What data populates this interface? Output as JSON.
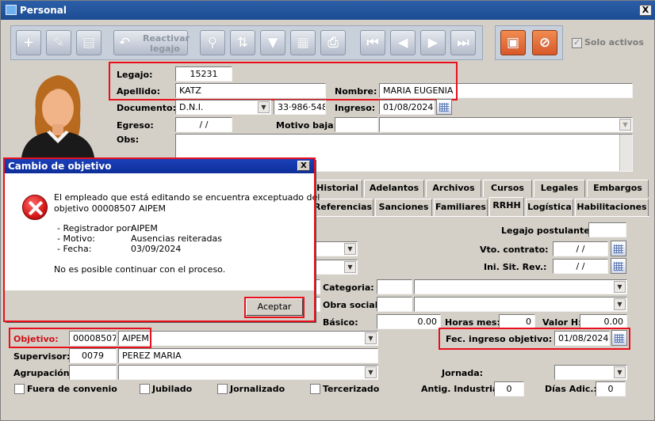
{
  "window": {
    "title": "Personal",
    "close": "X"
  },
  "toolbar": {
    "reactivate_label": "Reactivar\nlegajo",
    "solo_activos_label": "Solo activos",
    "solo_activos_checked": true
  },
  "form": {
    "legajo_label": "Legajo:",
    "legajo_value": "15231",
    "apellido_label": "Apellido:",
    "apellido_value": "KATZ",
    "nombre_label": "Nombre:",
    "nombre_value": "MARIA EUGENIA",
    "documento_label": "Documento:",
    "documento_type": "D.N.I.",
    "documento_number": "33·986·548",
    "ingreso_label": "Ingreso:",
    "ingreso_value": "01/08/2024",
    "egreso_label": "Egreso:",
    "egreso_value": "/ /",
    "motivo_baja_label": "Motivo baja:",
    "obs_label": "Obs:"
  },
  "tabs_row1": [
    "Historial",
    "Adelantos",
    "Archivos",
    "Cursos",
    "Legales",
    "Embargos"
  ],
  "tabs_row2": [
    "Referencias",
    "Sanciones",
    "Familiares",
    "RRHH",
    "Logística",
    "Habilitaciones"
  ],
  "rrhh": {
    "legajo_postulante_label": "Legajo postulante:",
    "vto_contrato_label": "Vto. contrato:",
    "vto_contrato_value": "/ /",
    "ini_sit_rev_label": "Ini. Sit. Rev.:",
    "ini_sit_rev_value": "/ /",
    "categoria_label": "Categoria:",
    "obra_social_label": "Obra social:",
    "basico_label": "Básico:",
    "basico_value": "0.00",
    "horas_mes_label": "Horas mes:",
    "horas_mes_value": "0",
    "valor_h_label": "Valor H:",
    "valor_h_value": "0.00",
    "objetivo_label": "Objetivo:",
    "objetivo_code": "00008507",
    "objetivo_name": "AIPEM",
    "fec_ingreso_objetivo_label": "Fec. ingreso objetivo:",
    "fec_ingreso_objetivo_value": "01/08/2024",
    "supervisor_label": "Supervisor:",
    "supervisor_code": "0079",
    "supervisor_name": "PEREZ MARIA",
    "agrupacion_label": "Agrupación:",
    "jornada_label": "Jornada:",
    "fuera_convenio_label": "Fuera de convenio",
    "jubilado_label": "Jubilado",
    "jornalizado_label": "Jornalizado",
    "tercerizado_label": "Tercerizado",
    "antig_industria_label": "Antig. Industria:",
    "antig_industria_value": "0",
    "dias_adic_label": "Días Adic.:",
    "dias_adic_value": "0"
  },
  "dialog": {
    "title": "Cambio de objetivo",
    "close": "X",
    "line1": "El empleado que está editando se encuentra exceptuado del",
    "line2": "objetivo 00008507 AIPEM",
    "registrador_label": "- Registrador por:",
    "registrador_value": "AIPEM",
    "motivo_label": "- Motivo:",
    "motivo_value": "Ausencias reiteradas",
    "fecha_label": "- Fecha:",
    "fecha_value": "03/09/2024",
    "footer": "No es posible continuar con el proceso.",
    "ok_button": "Aceptar"
  },
  "colors": {
    "highlight": "#e8101c",
    "titlebar": "#1c4d93",
    "dialog_titlebar": "#0e2f9a"
  }
}
